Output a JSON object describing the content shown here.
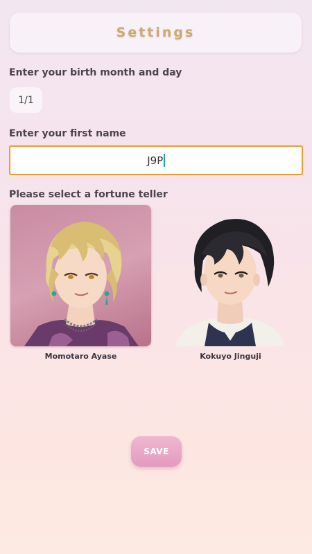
{
  "header": {
    "title": "Settings"
  },
  "birthday": {
    "label": "Enter your birth month and day",
    "value": "1/1"
  },
  "first_name": {
    "label": "Enter your first name",
    "value": "J9P"
  },
  "fortune_teller": {
    "label": "Please select a fortune teller",
    "tellers": [
      {
        "name": "Momotaro Ayase",
        "selected": true,
        "portrait": "blond-haired man portrait"
      },
      {
        "name": "Kokuyo Jinguji",
        "selected": false,
        "portrait": "black-haired man portrait"
      }
    ]
  },
  "save": {
    "label": "SAVE"
  },
  "colors": {
    "accent": "#c9aa72",
    "input_border": "#f29a2e",
    "save_button": "#e9a6c8"
  }
}
